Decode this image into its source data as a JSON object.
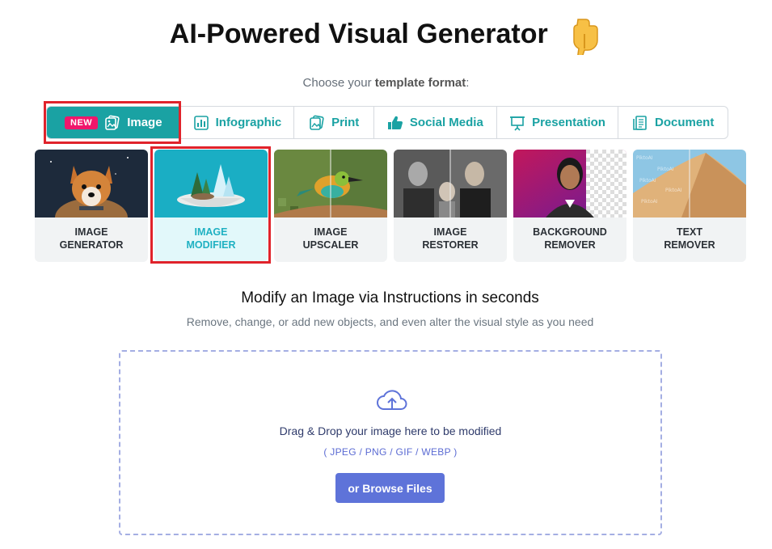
{
  "header": {
    "title": "AI-Powered Visual Generator",
    "choose_prefix": "Choose your ",
    "choose_bold": "template format",
    "choose_suffix": ":"
  },
  "tabs": [
    {
      "label": "Image",
      "badge": "NEW",
      "icon": "image-icon",
      "active": true
    },
    {
      "label": "Infographic",
      "icon": "bar-chart-icon",
      "active": false
    },
    {
      "label": "Print",
      "icon": "print-image-icon",
      "active": false
    },
    {
      "label": "Social Media",
      "icon": "thumbs-up-icon",
      "active": false
    },
    {
      "label": "Presentation",
      "icon": "presentation-board-icon",
      "active": false
    },
    {
      "label": "Document",
      "icon": "document-icon",
      "active": false
    }
  ],
  "cards": [
    {
      "line1": "IMAGE",
      "line2": "GENERATOR",
      "selected": false
    },
    {
      "line1": "IMAGE",
      "line2": "MODIFIER",
      "selected": true
    },
    {
      "line1": "IMAGE",
      "line2": "UPSCALER",
      "selected": false
    },
    {
      "line1": "IMAGE",
      "line2": "RESTORER",
      "selected": false
    },
    {
      "line1": "BACKGROUND",
      "line2": "REMOVER",
      "selected": false
    },
    {
      "line1": "TEXT",
      "line2": "REMOVER",
      "selected": false
    }
  ],
  "section": {
    "title": "Modify an Image via Instructions in seconds",
    "subtitle": "Remove, change, or add new objects, and even alter the visual style as you need"
  },
  "upload": {
    "text": "Drag & Drop your image here to be modified",
    "formats": "( JPEG / PNG / GIF / WEBP )",
    "button": "or Browse Files"
  },
  "colors": {
    "accent": "#1aa2a3",
    "badge": "#f0166b",
    "button": "#5e73d9",
    "highlight": "#e0232b"
  }
}
